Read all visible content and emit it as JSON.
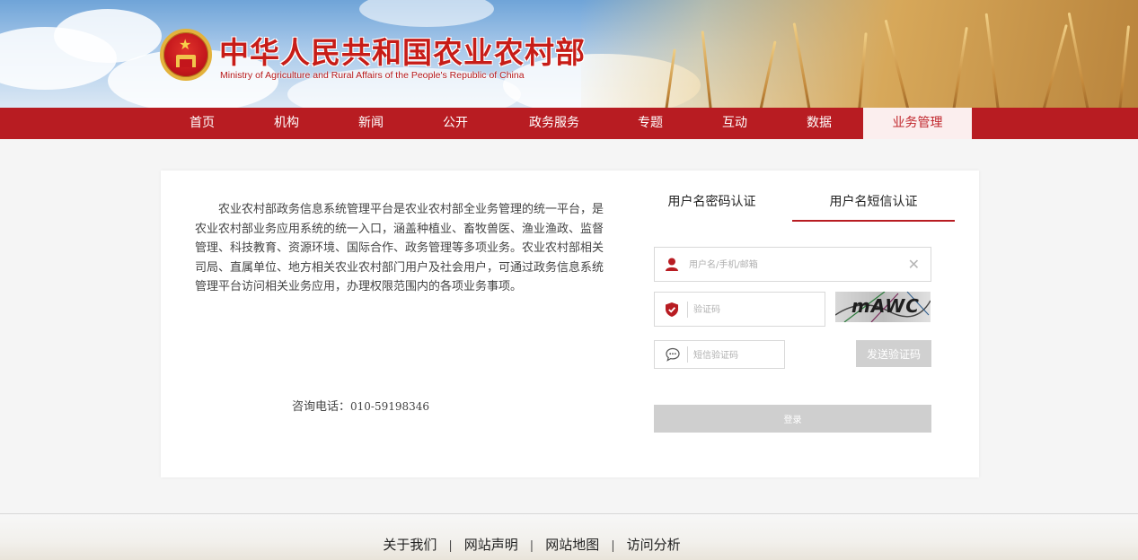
{
  "header": {
    "title_cn": "中华人民共和国农业农村部",
    "title_en": "Ministry of Agriculture and Rural Affairs of the People's Republic of China",
    "emblem_icon": "national-emblem-icon"
  },
  "nav": {
    "items": [
      {
        "label": "首页"
      },
      {
        "label": "机构"
      },
      {
        "label": "新闻"
      },
      {
        "label": "公开"
      },
      {
        "label": "政务服务"
      },
      {
        "label": "专题"
      },
      {
        "label": "互动"
      },
      {
        "label": "数据"
      },
      {
        "label": "业务管理",
        "active": true
      }
    ],
    "background": "#b81c22",
    "active_background": "#fbeeee"
  },
  "intro": {
    "text": "农业农村部政务信息系统管理平台是农业农村部全业务管理的统一平台，是农业农村部业务应用系统的统一入口，涵盖种植业、畜牧兽医、渔业渔政、监督管理、科技教育、资源环境、国际合作、政务管理等多项业务。农业农村部相关司局、直属单位、地方相关农业农村部门用户及社会用户，可通过政务信息系统管理平台访问相关业务应用，办理权限范围内的各项业务事项。",
    "hotline_label": "咨询电话：",
    "hotline_number": "010-59198346"
  },
  "login": {
    "tabs": [
      {
        "label": "用户名密码认证",
        "active": false
      },
      {
        "label": "用户名短信认证",
        "active": true
      }
    ],
    "username_placeholder": "用户名/手机/邮箱",
    "username_value": "",
    "captcha_placeholder": "验证码",
    "captcha_value": "",
    "captcha_text": "mAWC",
    "sms_placeholder": "短信验证码",
    "sms_value": "",
    "send_code_label": "发送验证码",
    "login_label": "登录",
    "accent_color": "#b81c22",
    "disabled_button_color": "#cfcfcf"
  },
  "footer": {
    "links": [
      "关于我们",
      "网站声明",
      "网站地图",
      "访问分析"
    ],
    "separator": "|"
  }
}
